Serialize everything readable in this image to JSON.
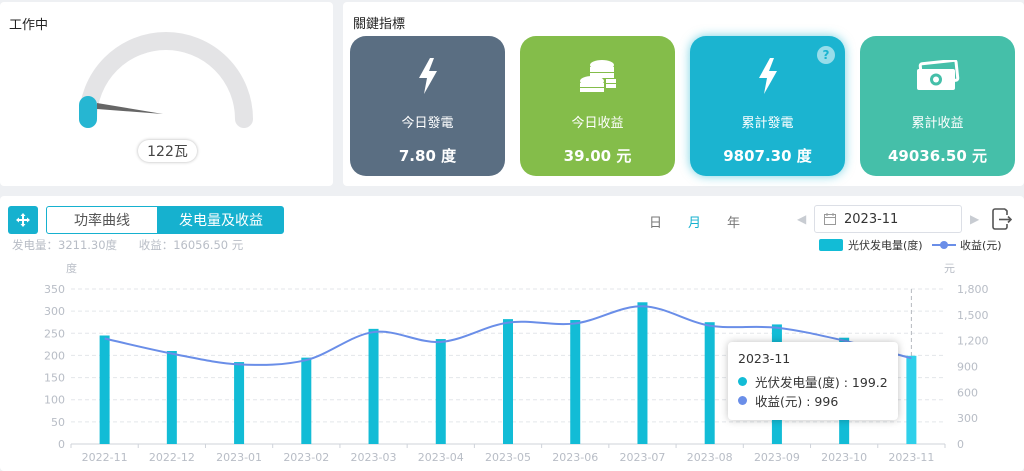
{
  "gauge": {
    "title": "工作中",
    "value_label": "122瓦",
    "level": 0.03
  },
  "kpi": {
    "title": "關鍵指標",
    "tiles": [
      {
        "label": "今日發電",
        "value": "7.80 度",
        "icon": "lightning-icon",
        "color": "#5a6e82"
      },
      {
        "label": "今日收益",
        "value": "39.00 元",
        "icon": "coins-icon",
        "color": "#84bd4a"
      },
      {
        "label": "累計發電",
        "value": "9807.30 度",
        "icon": "lightning-icon",
        "color": "#1bb4d0",
        "help": "?"
      },
      {
        "label": "累計收益",
        "value": "49036.50 元",
        "icon": "banknotes-icon",
        "color": "#45bfa9"
      }
    ]
  },
  "chart_panel": {
    "tabs": [
      "功率曲线",
      "发电量及收益"
    ],
    "active_tab": 1,
    "summary": {
      "energy": "发电量：3211.30度",
      "income": "收益：16056.50 元"
    },
    "periods": [
      "日",
      "月",
      "年"
    ],
    "active_period": 1,
    "date": "2023-11",
    "legend": {
      "bar": "光伏发电量(度)",
      "line": "收益(元)"
    },
    "tooltip": {
      "title": "2023-11",
      "bar_row": "光伏发电量(度) : 199.2",
      "line_row": "收益(元) : 996"
    }
  },
  "chart_data": {
    "type": "bar",
    "categories": [
      "2022-11",
      "2022-12",
      "2023-01",
      "2023-02",
      "2023-03",
      "2023-04",
      "2023-05",
      "2023-06",
      "2023-07",
      "2023-08",
      "2023-09",
      "2023-10",
      "2023-11"
    ],
    "series": [
      {
        "name": "光伏发电量(度)",
        "type": "bar",
        "axis": "left",
        "values": [
          245,
          210,
          185,
          195,
          260,
          237,
          282,
          280,
          320,
          275,
          270,
          240,
          199.2
        ]
      },
      {
        "name": "收益(元)",
        "type": "line",
        "axis": "right",
        "values": [
          1225,
          1050,
          925,
          975,
          1300,
          1185,
          1410,
          1400,
          1600,
          1375,
          1350,
          1200,
          996
        ]
      }
    ],
    "left_axis": {
      "label": "度",
      "ylim": [
        0,
        350
      ],
      "ticks": [
        0,
        50,
        100,
        150,
        200,
        250,
        300,
        350
      ]
    },
    "right_axis": {
      "label": "元",
      "ylim": [
        0,
        1800
      ],
      "ticks": [
        "0",
        "300",
        "600",
        "900",
        "1,200",
        "1,500",
        "1,800"
      ]
    },
    "highlight_index": 12,
    "colors": {
      "bar": "#12bcd6",
      "line": "#6a8ee8"
    },
    "grid": true,
    "legend_position": "top-right"
  }
}
